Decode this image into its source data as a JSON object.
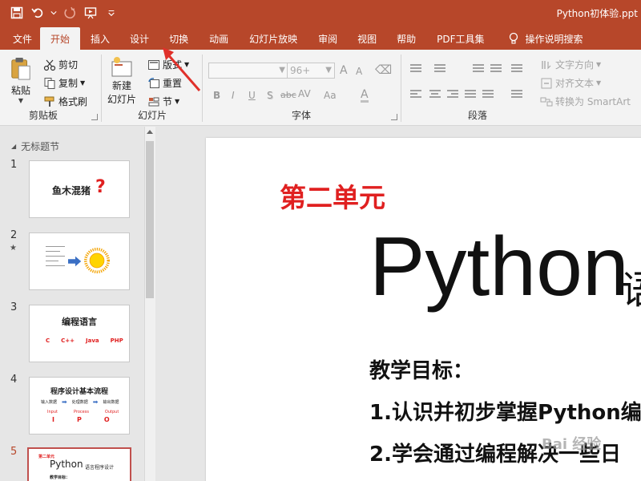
{
  "window": {
    "title": "Python初体验.ppt"
  },
  "tabs": [
    {
      "label": "文件"
    },
    {
      "label": "开始"
    },
    {
      "label": "插入"
    },
    {
      "label": "设计"
    },
    {
      "label": "切换"
    },
    {
      "label": "动画"
    },
    {
      "label": "幻灯片放映"
    },
    {
      "label": "审阅"
    },
    {
      "label": "视图"
    },
    {
      "label": "帮助"
    },
    {
      "label": "PDF工具集"
    },
    {
      "label": "操作说明搜索"
    }
  ],
  "ribbon": {
    "clipboard": {
      "label": "剪贴板",
      "paste": "粘贴",
      "cut": "剪切",
      "copy": "复制",
      "painter": "格式刷"
    },
    "slides": {
      "label": "幻灯片",
      "new_slide_1": "新建",
      "new_slide_2": "幻灯片",
      "layout": "版式",
      "reset": "重置",
      "section": "节"
    },
    "font": {
      "label": "字体",
      "size": "96+",
      "bold": "B",
      "italic": "I",
      "underline": "U",
      "shadow": "S",
      "strike": "abc",
      "spacing": "AV",
      "case": "Aa",
      "color": "A",
      "grow": "A",
      "shrink": "A"
    },
    "paragraph": {
      "label": "段落",
      "direction": "文字方向",
      "align": "对齐文本",
      "smartart": "转换为 SmartArt"
    }
  },
  "pane": {
    "section": "无标题节",
    "slides": [
      {
        "num": "1",
        "text": "鱼木混猪"
      },
      {
        "num": "2"
      },
      {
        "num": "3",
        "title": "编程语言",
        "langs": [
          "C",
          "C++",
          "Java",
          "PHP"
        ]
      },
      {
        "num": "4",
        "title": "程序设计基本流程",
        "flow": [
          "输入数据",
          "处理数据",
          "输出数据"
        ],
        "eng": [
          "Input",
          "Process",
          "Output"
        ],
        "letters": [
          "I",
          "P",
          "O"
        ]
      },
      {
        "num": "5",
        "unit": "第二单元",
        "title": "Python",
        "sub": "语言程序设计",
        "goal": "教学目标："
      }
    ]
  },
  "slide": {
    "unit": "第二单元",
    "title": "Python",
    "title_cut": "语",
    "lines": [
      "教学目标：",
      "1.认识并初步掌握Python编",
      "2.学会通过编程解决一些日"
    ]
  },
  "watermark": "Bai 经验",
  "colors": {
    "accent": "#b7472a",
    "slide_red": "#e02020"
  }
}
